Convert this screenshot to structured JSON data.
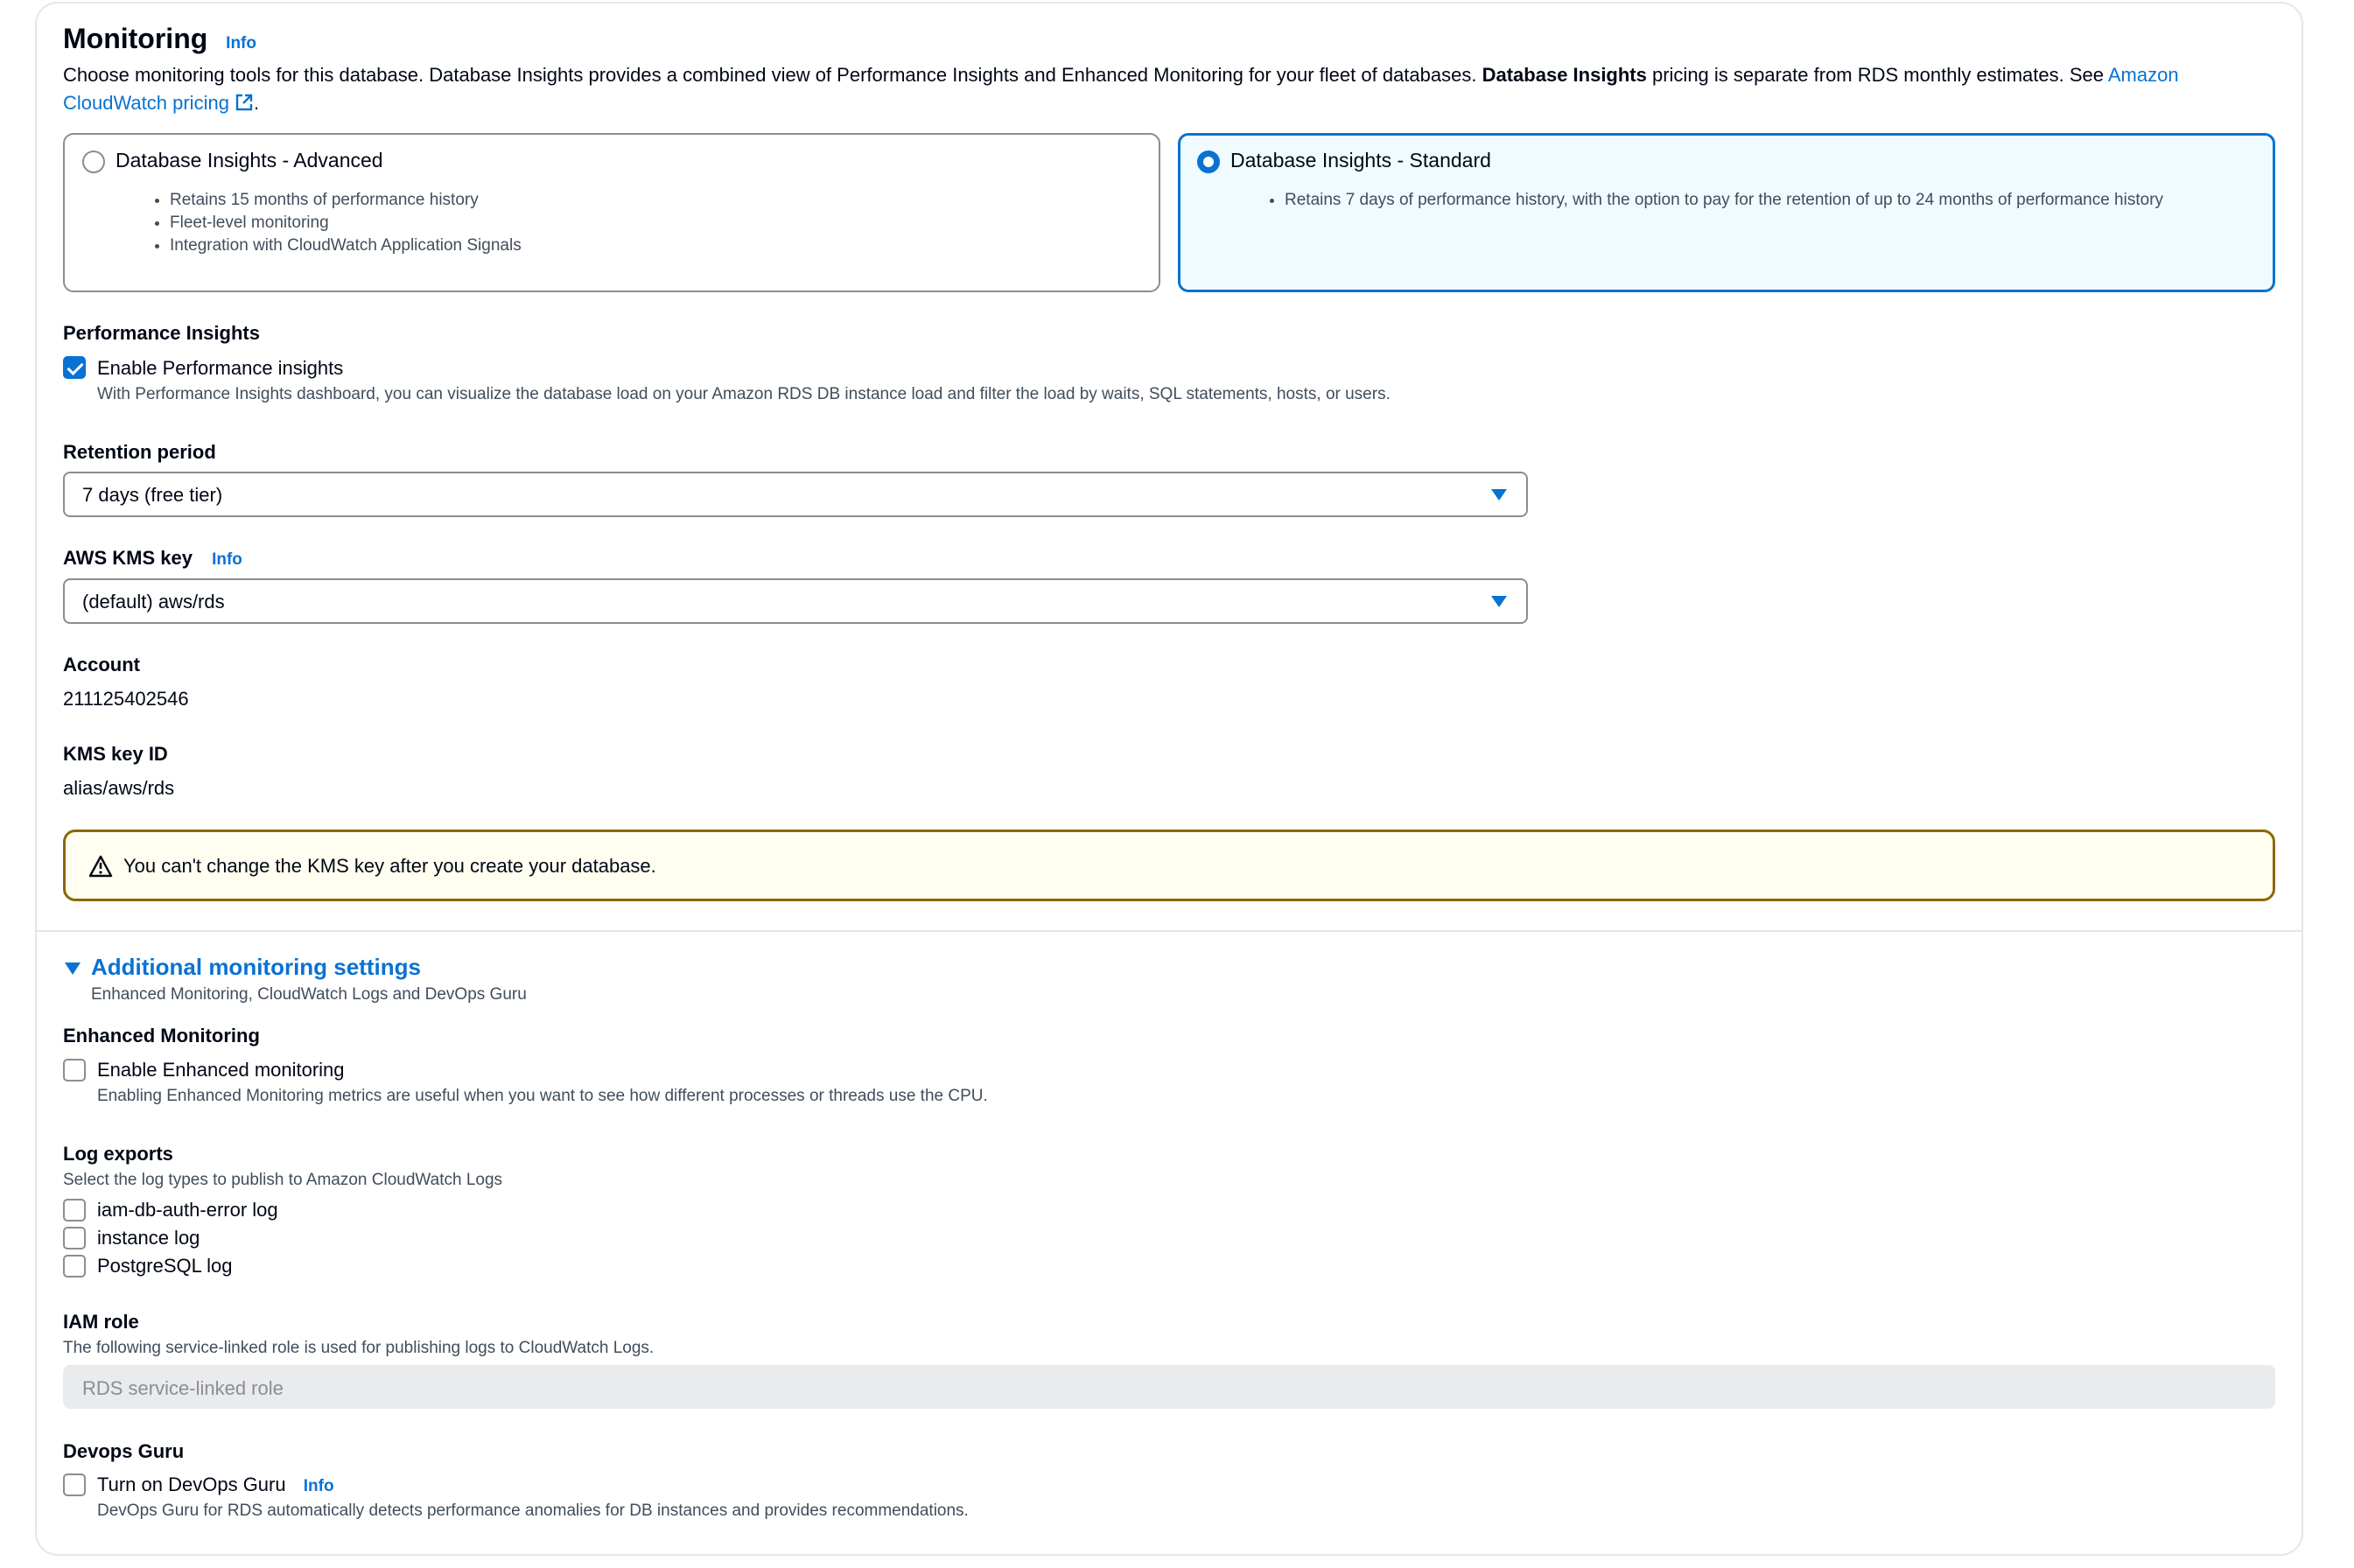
{
  "monitoring": {
    "title": "Monitoring",
    "info": "Info",
    "desc_part1": "Choose monitoring tools for this database. Database Insights provides a combined view of Performance Insights and Enhanced Monitoring for your fleet of databases. ",
    "desc_bold": "Database Insights",
    "desc_part2": " pricing is separate from RDS monthly estimates. See ",
    "desc_link": "Amazon CloudWatch pricing",
    "desc_end": "."
  },
  "tiles": {
    "advanced": {
      "label": "Database Insights - Advanced",
      "selected": false,
      "bullets": [
        "Retains 15 months of performance history",
        "Fleet-level monitoring",
        "Integration with CloudWatch Application Signals"
      ]
    },
    "standard": {
      "label": "Database Insights - Standard",
      "selected": true,
      "bullets": [
        "Retains 7 days of performance history, with the option to pay for the retention of up to 24 months of performance history"
      ]
    }
  },
  "performance_insights": {
    "label": "Performance Insights",
    "checkbox_label": "Enable Performance insights",
    "checked": true,
    "description": "With Performance Insights dashboard, you can visualize the database load on your Amazon RDS DB instance load and filter the load by waits, SQL statements, hosts, or users."
  },
  "retention": {
    "label": "Retention period",
    "value": "7 days (free tier)"
  },
  "kms": {
    "label": "AWS KMS key",
    "info": "Info",
    "value": "(default) aws/rds"
  },
  "account": {
    "label": "Account",
    "value": "211125402546"
  },
  "kms_key_id": {
    "label": "KMS key ID",
    "value": "alias/aws/rds"
  },
  "alert": {
    "text": "You can't change the KMS key after you create your database."
  },
  "additional": {
    "title": "Additional monitoring settings",
    "subtitle": "Enhanced Monitoring, CloudWatch Logs and DevOps Guru"
  },
  "enhanced": {
    "label": "Enhanced Monitoring",
    "checkbox_label": "Enable Enhanced monitoring",
    "checked": false,
    "description": "Enabling Enhanced Monitoring metrics are useful when you want to see how different processes or threads use the CPU."
  },
  "logs": {
    "label": "Log exports",
    "description": "Select the log types to publish to Amazon CloudWatch Logs",
    "items": [
      {
        "label": "iam-db-auth-error log",
        "checked": false
      },
      {
        "label": "instance log",
        "checked": false
      },
      {
        "label": "PostgreSQL log",
        "checked": false
      }
    ]
  },
  "iam": {
    "label": "IAM role",
    "description": "The following service-linked role is used for publishing logs to CloudWatch Logs.",
    "value": "RDS service-linked role"
  },
  "devops": {
    "label": "Devops Guru",
    "checkbox_label": "Turn on DevOps Guru",
    "info": "Info",
    "checked": false,
    "description": "DevOps Guru for RDS automatically detects performance anomalies for DB instances and provides recommendations."
  },
  "colors": {
    "accent": "#0972d3",
    "warning_border": "#8d6605",
    "warning_bg": "#fffef0",
    "selected_tile_bg": "#f0fbff"
  }
}
